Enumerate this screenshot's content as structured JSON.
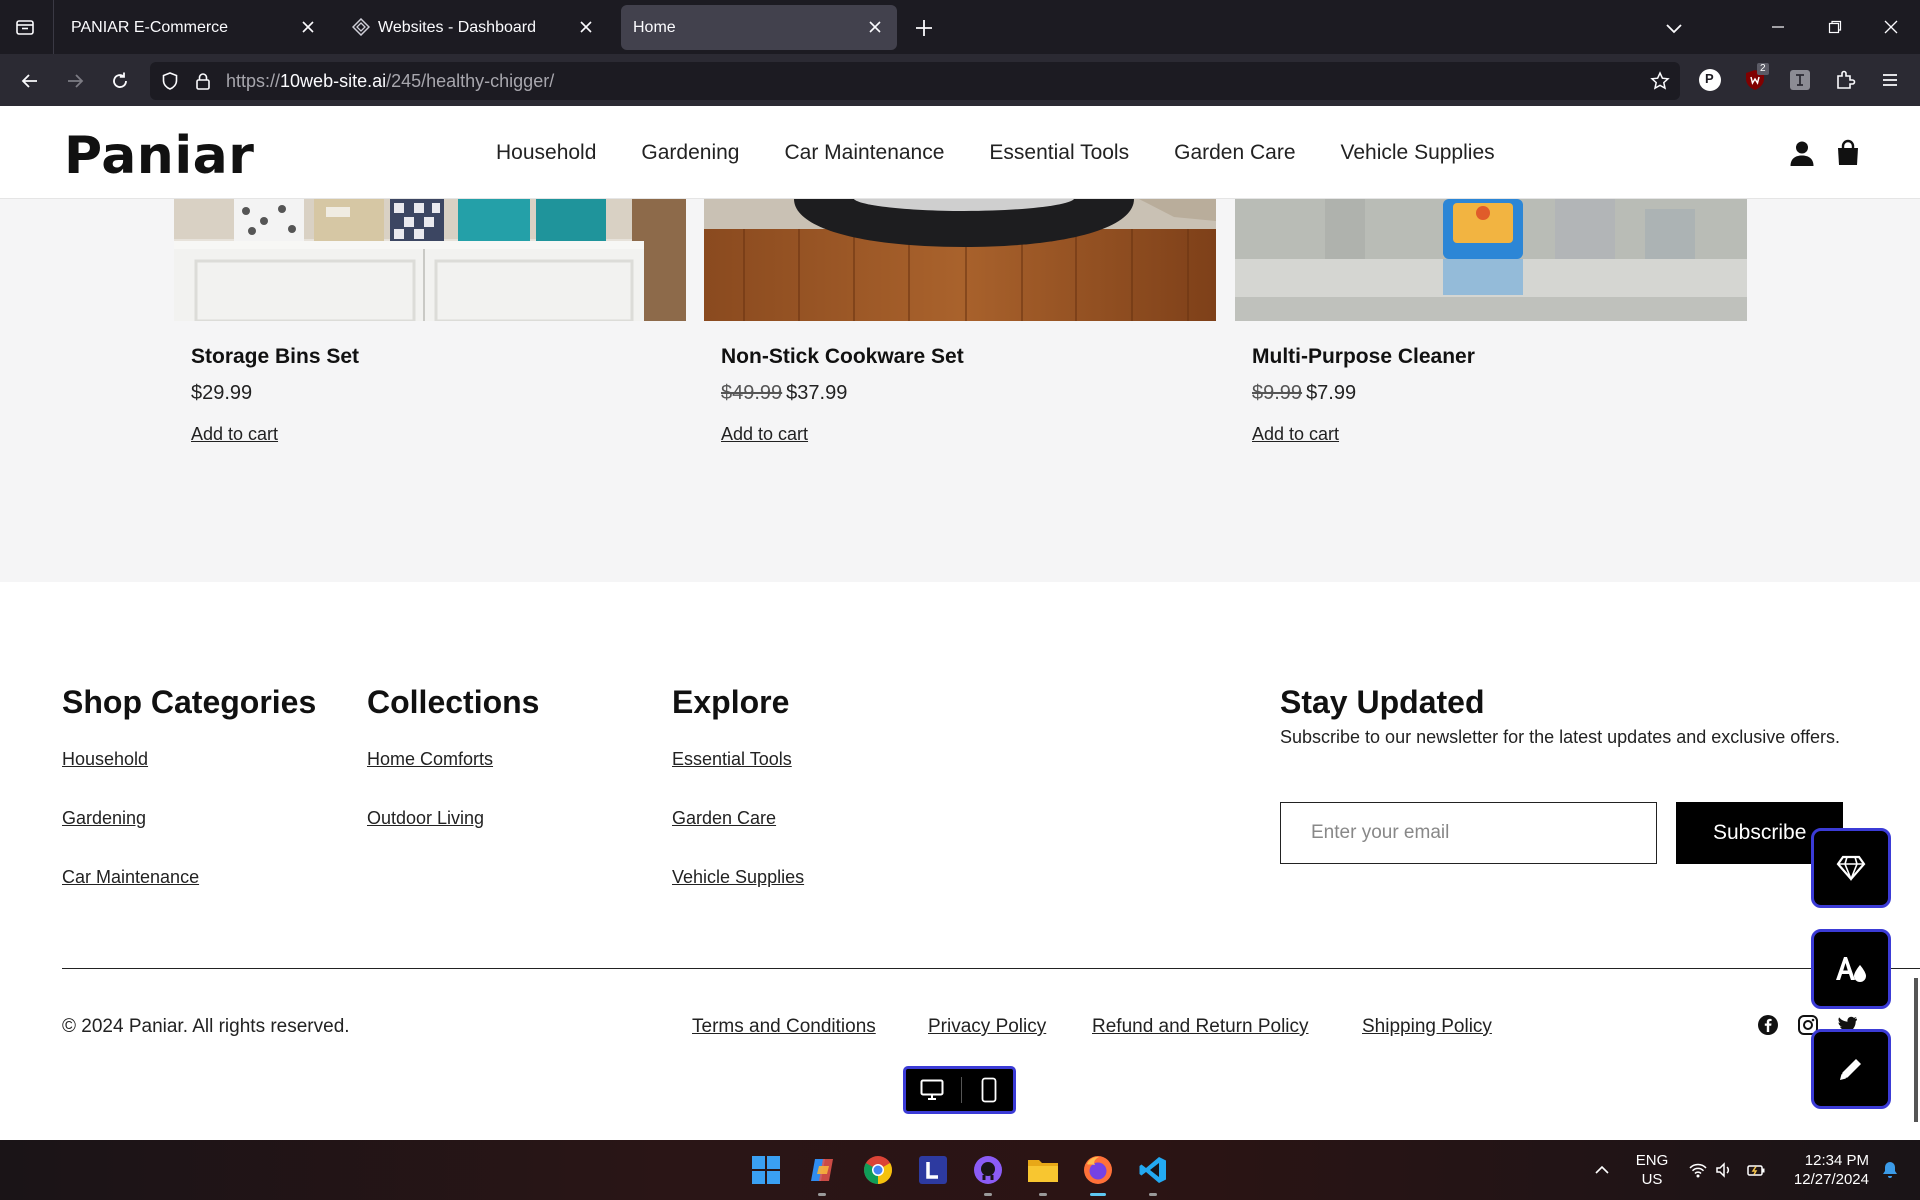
{
  "browser": {
    "tabs": [
      {
        "title": "PANIAR E-Commerce",
        "active": false
      },
      {
        "title": "Websites - Dashboard",
        "active": false
      },
      {
        "title": "Home",
        "active": true
      }
    ],
    "url_scheme": "https://",
    "url_host": "10web-site.ai",
    "url_path": "/245/healthy-chigger/",
    "extension_badge": "2",
    "profile_letter": "P"
  },
  "header": {
    "logo": "Paniar",
    "nav": [
      "Household",
      "Gardening",
      "Car Maintenance",
      "Essential Tools",
      "Garden Care",
      "Vehicle Supplies"
    ]
  },
  "products": [
    {
      "name": "Storage Bins Set",
      "old_price": "",
      "price": "$29.99",
      "cta": "Add to cart"
    },
    {
      "name": "Non-Stick Cookware Set",
      "old_price": "$49.99",
      "price": "$37.99",
      "cta": "Add to cart"
    },
    {
      "name": "Multi-Purpose Cleaner",
      "old_price": "$9.99",
      "price": "$7.99",
      "cta": "Add to cart"
    }
  ],
  "footer": {
    "shop_categories": {
      "title": "Shop Categories",
      "links": [
        "Household",
        "Gardening",
        "Car Maintenance"
      ]
    },
    "collections": {
      "title": "Collections",
      "links": [
        "Home Comforts",
        "Outdoor Living"
      ]
    },
    "explore": {
      "title": "Explore",
      "links": [
        "Essential Tools",
        "Garden Care",
        "Vehicle Supplies"
      ]
    },
    "newsletter": {
      "title": "Stay Updated",
      "text": "Subscribe to our newsletter for the latest updates and exclusive offers.",
      "placeholder": "Enter your email",
      "button": "Subscribe"
    },
    "copyright": "© 2024 Paniar. All rights reserved.",
    "legal_links": [
      "Terms and Conditions",
      "Privacy Policy",
      "Refund and Return Policy",
      "Shipping Policy"
    ]
  },
  "taskbar": {
    "lang_top": "ENG",
    "lang_bottom": "US",
    "time": "12:34 PM",
    "date": "12/27/2024"
  }
}
